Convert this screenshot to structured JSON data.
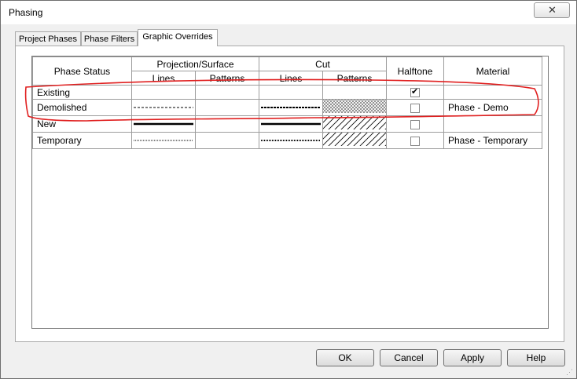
{
  "window": {
    "title": "Phasing",
    "close_icon": "close-icon"
  },
  "tabs": [
    {
      "label": "Project Phases",
      "active": false
    },
    {
      "label": "Phase Filters",
      "active": false
    },
    {
      "label": "Graphic Overrides",
      "active": true
    }
  ],
  "grid": {
    "headers": {
      "phase_status": "Phase Status",
      "projection_surface": "Projection/Surface",
      "cut": "Cut",
      "halftone": "Halftone",
      "material": "Material",
      "lines": "Lines",
      "patterns": "Patterns"
    },
    "rows": [
      {
        "name": "Existing",
        "proj_lines": "none",
        "proj_patterns": "none",
        "cut_lines": "none",
        "cut_patterns": "none",
        "halftone": true,
        "material": ""
      },
      {
        "name": "Demolished",
        "proj_lines": "dashed",
        "proj_patterns": "none",
        "cut_lines": "dashed-bold",
        "cut_patterns": "crosshatch",
        "halftone": false,
        "material": "Phase - Demo"
      },
      {
        "name": "New",
        "proj_lines": "solid-bold",
        "proj_patterns": "none",
        "cut_lines": "solid-bold",
        "cut_patterns": "diagonal",
        "halftone": false,
        "material": ""
      },
      {
        "name": "Temporary",
        "proj_lines": "dotted",
        "proj_patterns": "none",
        "cut_lines": "dotted-bold",
        "cut_patterns": "diagonal",
        "halftone": false,
        "material": "Phase - Temporary"
      }
    ]
  },
  "buttons": {
    "ok": "OK",
    "cancel": "Cancel",
    "apply": "Apply",
    "help": "Help"
  },
  "annotation": {
    "color": "#e02020"
  }
}
